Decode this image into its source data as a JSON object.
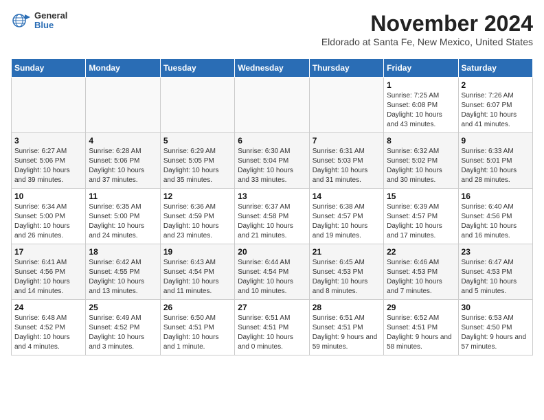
{
  "logo": {
    "general": "General",
    "blue": "Blue"
  },
  "header": {
    "month": "November 2024",
    "location": "Eldorado at Santa Fe, New Mexico, United States"
  },
  "weekdays": [
    "Sunday",
    "Monday",
    "Tuesday",
    "Wednesday",
    "Thursday",
    "Friday",
    "Saturday"
  ],
  "weeks": [
    [
      {
        "day": "",
        "info": ""
      },
      {
        "day": "",
        "info": ""
      },
      {
        "day": "",
        "info": ""
      },
      {
        "day": "",
        "info": ""
      },
      {
        "day": "",
        "info": ""
      },
      {
        "day": "1",
        "info": "Sunrise: 7:25 AM\nSunset: 6:08 PM\nDaylight: 10 hours and 43 minutes."
      },
      {
        "day": "2",
        "info": "Sunrise: 7:26 AM\nSunset: 6:07 PM\nDaylight: 10 hours and 41 minutes."
      }
    ],
    [
      {
        "day": "3",
        "info": "Sunrise: 6:27 AM\nSunset: 5:06 PM\nDaylight: 10 hours and 39 minutes."
      },
      {
        "day": "4",
        "info": "Sunrise: 6:28 AM\nSunset: 5:06 PM\nDaylight: 10 hours and 37 minutes."
      },
      {
        "day": "5",
        "info": "Sunrise: 6:29 AM\nSunset: 5:05 PM\nDaylight: 10 hours and 35 minutes."
      },
      {
        "day": "6",
        "info": "Sunrise: 6:30 AM\nSunset: 5:04 PM\nDaylight: 10 hours and 33 minutes."
      },
      {
        "day": "7",
        "info": "Sunrise: 6:31 AM\nSunset: 5:03 PM\nDaylight: 10 hours and 31 minutes."
      },
      {
        "day": "8",
        "info": "Sunrise: 6:32 AM\nSunset: 5:02 PM\nDaylight: 10 hours and 30 minutes."
      },
      {
        "day": "9",
        "info": "Sunrise: 6:33 AM\nSunset: 5:01 PM\nDaylight: 10 hours and 28 minutes."
      }
    ],
    [
      {
        "day": "10",
        "info": "Sunrise: 6:34 AM\nSunset: 5:00 PM\nDaylight: 10 hours and 26 minutes."
      },
      {
        "day": "11",
        "info": "Sunrise: 6:35 AM\nSunset: 5:00 PM\nDaylight: 10 hours and 24 minutes."
      },
      {
        "day": "12",
        "info": "Sunrise: 6:36 AM\nSunset: 4:59 PM\nDaylight: 10 hours and 23 minutes."
      },
      {
        "day": "13",
        "info": "Sunrise: 6:37 AM\nSunset: 4:58 PM\nDaylight: 10 hours and 21 minutes."
      },
      {
        "day": "14",
        "info": "Sunrise: 6:38 AM\nSunset: 4:57 PM\nDaylight: 10 hours and 19 minutes."
      },
      {
        "day": "15",
        "info": "Sunrise: 6:39 AM\nSunset: 4:57 PM\nDaylight: 10 hours and 17 minutes."
      },
      {
        "day": "16",
        "info": "Sunrise: 6:40 AM\nSunset: 4:56 PM\nDaylight: 10 hours and 16 minutes."
      }
    ],
    [
      {
        "day": "17",
        "info": "Sunrise: 6:41 AM\nSunset: 4:56 PM\nDaylight: 10 hours and 14 minutes."
      },
      {
        "day": "18",
        "info": "Sunrise: 6:42 AM\nSunset: 4:55 PM\nDaylight: 10 hours and 13 minutes."
      },
      {
        "day": "19",
        "info": "Sunrise: 6:43 AM\nSunset: 4:54 PM\nDaylight: 10 hours and 11 minutes."
      },
      {
        "day": "20",
        "info": "Sunrise: 6:44 AM\nSunset: 4:54 PM\nDaylight: 10 hours and 10 minutes."
      },
      {
        "day": "21",
        "info": "Sunrise: 6:45 AM\nSunset: 4:53 PM\nDaylight: 10 hours and 8 minutes."
      },
      {
        "day": "22",
        "info": "Sunrise: 6:46 AM\nSunset: 4:53 PM\nDaylight: 10 hours and 7 minutes."
      },
      {
        "day": "23",
        "info": "Sunrise: 6:47 AM\nSunset: 4:53 PM\nDaylight: 10 hours and 5 minutes."
      }
    ],
    [
      {
        "day": "24",
        "info": "Sunrise: 6:48 AM\nSunset: 4:52 PM\nDaylight: 10 hours and 4 minutes."
      },
      {
        "day": "25",
        "info": "Sunrise: 6:49 AM\nSunset: 4:52 PM\nDaylight: 10 hours and 3 minutes."
      },
      {
        "day": "26",
        "info": "Sunrise: 6:50 AM\nSunset: 4:51 PM\nDaylight: 10 hours and 1 minute."
      },
      {
        "day": "27",
        "info": "Sunrise: 6:51 AM\nSunset: 4:51 PM\nDaylight: 10 hours and 0 minutes."
      },
      {
        "day": "28",
        "info": "Sunrise: 6:51 AM\nSunset: 4:51 PM\nDaylight: 9 hours and 59 minutes."
      },
      {
        "day": "29",
        "info": "Sunrise: 6:52 AM\nSunset: 4:51 PM\nDaylight: 9 hours and 58 minutes."
      },
      {
        "day": "30",
        "info": "Sunrise: 6:53 AM\nSunset: 4:50 PM\nDaylight: 9 hours and 57 minutes."
      }
    ]
  ]
}
